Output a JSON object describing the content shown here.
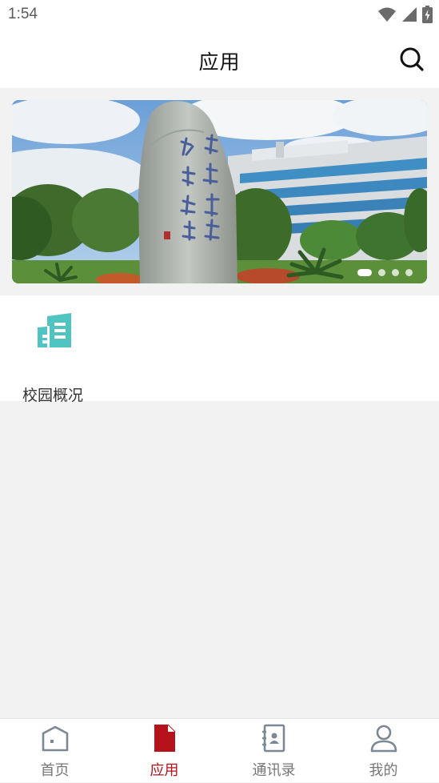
{
  "status_bar": {
    "time": "1:54"
  },
  "header": {
    "title": "应用"
  },
  "banner": {
    "slide_count": 4,
    "active_index": 0
  },
  "apps": [
    {
      "label": "校园概况",
      "icon": "building-icon",
      "color": "#4fc4c0"
    }
  ],
  "tabs": [
    {
      "label": "首页",
      "icon": "home-icon",
      "active": false
    },
    {
      "label": "应用",
      "icon": "document-icon",
      "active": true
    },
    {
      "label": "通讯录",
      "icon": "contacts-book-icon",
      "active": false
    },
    {
      "label": "我的",
      "icon": "user-icon",
      "active": false
    }
  ],
  "colors": {
    "accent": "#b5121b",
    "inactive": "#7c8896",
    "app_teal": "#4fc4c0"
  }
}
